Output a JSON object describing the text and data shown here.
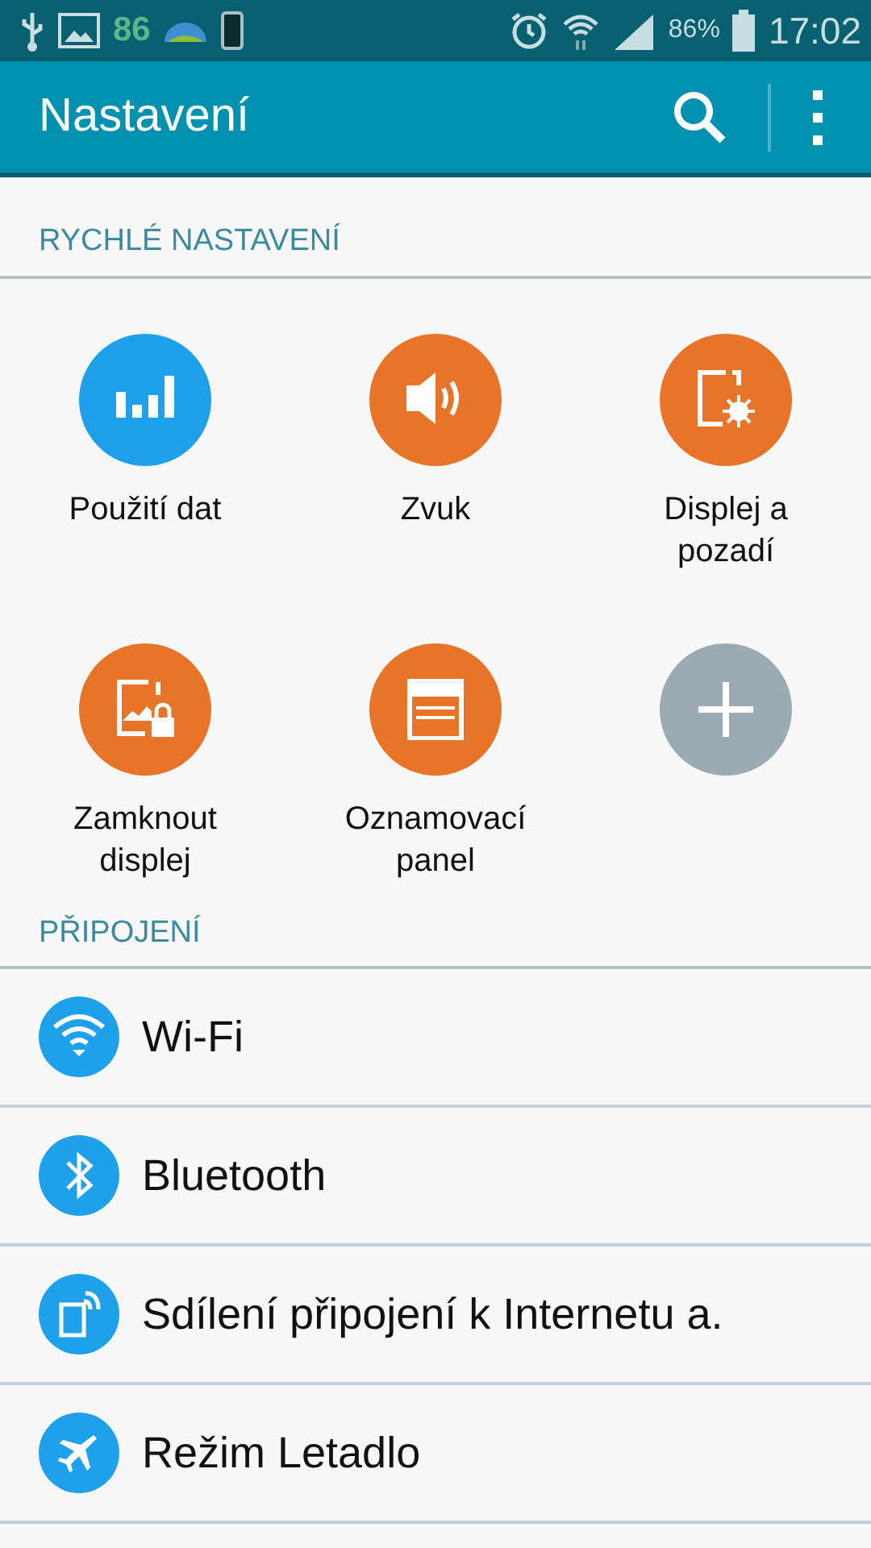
{
  "status_bar": {
    "notification_count": "86",
    "battery_percent": "86%",
    "time": "17:02"
  },
  "app_bar": {
    "title": "Nastavení"
  },
  "quick_settings": {
    "header": "RYCHLÉ NASTAVENÍ",
    "tiles": [
      {
        "kind": "shortcut",
        "label": "Použití dat",
        "color": "#1fa0ea"
      },
      {
        "kind": "shortcut",
        "label": "Zvuk",
        "color": "#e8742a"
      },
      {
        "kind": "shortcut",
        "label": "Displej a pozadí",
        "color": "#e8742a"
      },
      {
        "kind": "shortcut",
        "label": "Zamknout displej",
        "color": "#e8742a"
      },
      {
        "kind": "shortcut",
        "label": "Oznamovací panel",
        "color": "#e8742a"
      },
      {
        "kind": "add",
        "color": "#9aabb4"
      }
    ]
  },
  "connections": {
    "header": "PŘIPOJENÍ",
    "items": [
      {
        "label": "Wi-Fi"
      },
      {
        "label": "Bluetooth"
      },
      {
        "label": "Sdílení připojení k Internetu a."
      },
      {
        "label": "Režim Letadlo"
      }
    ]
  }
}
